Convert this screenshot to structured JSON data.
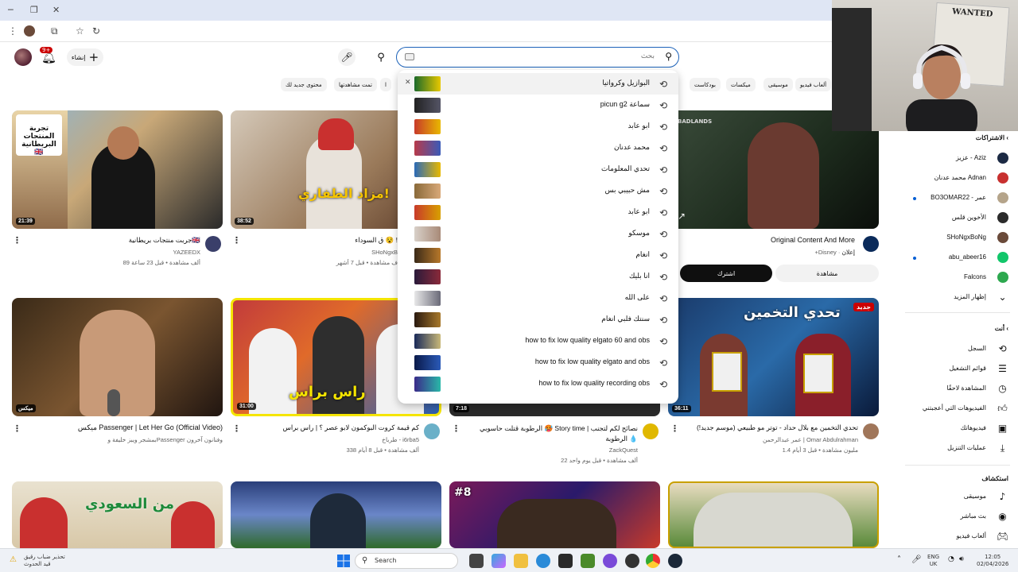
{
  "header": {
    "notifications_badge": "9+",
    "create_label": "إنشاء",
    "search_placeholder": "بحث"
  },
  "chips": [
    "ألعاب فيديو",
    "موسيقى",
    "ميكسات",
    "بودكاست",
    "تمت مشاهدتها",
    "محتوى جديد لك"
  ],
  "search_suggestions": [
    {
      "text": "البوازيل وكرواتيا",
      "highlighted": true,
      "removable": true
    },
    {
      "text": "picun g2 سماعة"
    },
    {
      "text": "ابو عابد"
    },
    {
      "text": "محمد عدنان"
    },
    {
      "text": "تحدي المعلومات"
    },
    {
      "text": "مش حبيبي بس"
    },
    {
      "text": "ابو عابد"
    },
    {
      "text": "موسكو"
    },
    {
      "text": "انغام"
    },
    {
      "text": "انا بليك"
    },
    {
      "text": "على الله"
    },
    {
      "text": "سنتك فلبي انغام"
    },
    {
      "text": "how to fix low quality elgato 60 and obs"
    },
    {
      "text": "how to fix low quality elgato and obs"
    },
    {
      "text": "how to fix low quality recording obs"
    }
  ],
  "videos": {
    "row1": [
      {
        "title": "جربت منتجات بريطانية🇬🇧",
        "channel": "YAZEEDX",
        "stats": "89 ألف مشاهدة • قبل 23 ساعة",
        "duration": "21:39",
        "thumb_text": "تجربة المنتجات البريطانية 🇬🇧"
      },
      {
        "title": "ق السوداء 😵 !",
        "channel": "SHoNgxB",
        "stats": "ف مشاهدة • قبل 7 أشهر",
        "duration": "38:52",
        "thumb_text": "مزاد الطفاري!"
      },
      {
        "title": "Original Content And More",
        "channel": "+Disney",
        "ad_label": "إعلان",
        "watch_label": "مشاهدة",
        "subscribe_label": "اشترك",
        "thumb_text": "BADLANDS"
      }
    ],
    "row2": [
      {
        "title": "ميكس Passenger | Let Her Go (Official Video)",
        "channel": "بمشجر ويبز خليفة وPassenger وفنانون آخرون",
        "duration_label": "ميكس"
      },
      {
        "title": "كم قيمة كروت البوكمون لابو عصر ؟ | راس براس",
        "channel": "طرباخ - i6rba5",
        "stats": "338 ألف مشاهدة • قبل 8 أيام",
        "duration": "31:00",
        "thumb_text": "راس براس"
      },
      {
        "title": "الرطوبة قتلت حاسوبي 🥵 Story time | نصائح لكم لتجنب الرطوبة 💧",
        "channel": "ZackQuest",
        "stats": "22 ألف مشاهدة • قبل يوم واحد",
        "duration": "7:18"
      },
      {
        "title": "تحدي التخمين مع بلال حداد - توتر مو طبيعي (موسم جديد!)",
        "channel": "عمر عبدالرحمن | Omar Abdulrahman",
        "stats": "1.4 مليون مشاهدة • قبل 3 أيام",
        "duration": "36:11",
        "badge": "جديد",
        "thumb_text": "تحدي التخمين"
      }
    ],
    "row3": [
      {
        "thumb_text": "من السعودي"
      },
      {
        "thumb_text": ""
      },
      {
        "thumb_text": "#8"
      },
      {
        "thumb_text": ""
      }
    ]
  },
  "sidebar": {
    "subscriptions_header": "الاشتراكات",
    "subscriptions": [
      {
        "label": "عزيز - Aziz",
        "color": "#1c2a44"
      },
      {
        "label": "محمد عدنان Adnan",
        "color": "#c8302f",
        "dot": true
      },
      {
        "label": "BO3OMAR22 - عمر",
        "color": "#b5a48a",
        "dot": true
      },
      {
        "label": "الأخوين قلس",
        "color": "#2b2b2b"
      },
      {
        "label": "SHoNgxBoNg",
        "color": "#6a4a3a"
      },
      {
        "label": "abu_abeer16",
        "color": "#12c66a",
        "dot": true
      },
      {
        "label": "Falcons",
        "color": "#2da84f"
      }
    ],
    "show_more_label": "إظهار المزيد",
    "you_header": "أنت",
    "you_items": [
      {
        "label": "السجل",
        "icon": "history-icon"
      },
      {
        "label": "قوائم التشغيل",
        "icon": "playlist-icon"
      },
      {
        "label": "المشاهدة لاحقًا",
        "icon": "clock-icon"
      },
      {
        "label": "الفيديوهات التي أعجبتني",
        "icon": "thumbs-up-icon"
      },
      {
        "label": "فيديوهاتك",
        "icon": "video-icon"
      },
      {
        "label": "عمليات التنزيل",
        "icon": "download-icon"
      }
    ],
    "explore_header": "استكشاف",
    "explore_items": [
      {
        "label": "موسيقى",
        "icon": "music-icon"
      },
      {
        "label": "بث مباشر",
        "icon": "live-icon"
      },
      {
        "label": "ألعاب فيديو",
        "icon": "gamepad-icon"
      }
    ]
  },
  "webcam": {
    "poster_text": "WANTED"
  },
  "taskbar": {
    "weather_line1": "تحذير ضباب رقيق",
    "weather_line2": "قيد الحدوث",
    "search_label": "Search",
    "lang_line1": "ENG",
    "lang_line2": "UK",
    "time": "12:05",
    "date": "02/04/2026"
  },
  "colors": {
    "accent": "#065fd4",
    "search_border": "#1c62b9",
    "new_badge": "#cc0000"
  }
}
